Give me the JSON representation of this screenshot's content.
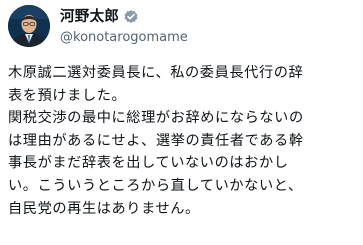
{
  "author": {
    "name": "河野太郎",
    "handle": "@konotarogomame",
    "avatar_icon": "avatar-portrait-icon",
    "verified_icon": "verified-badge-icon",
    "verified_color": "#8a9aa8"
  },
  "post": {
    "lines": [
      "木原誠二選対委員長に、私の委員長代行の辞",
      "表を預けました。",
      "関税交渉の最中に総理がお辞めにならないの",
      "は理由があるにせよ、選挙の責任者である幹",
      "事長がまだ辞表を出していないのはおかし",
      "い。こういうところから直していかないと、",
      "自民党の再生はありません。"
    ]
  }
}
